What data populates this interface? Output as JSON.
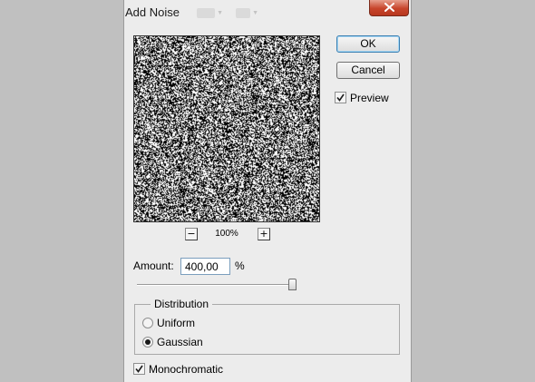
{
  "dialog": {
    "title": "Add Noise",
    "ok_label": "OK",
    "cancel_label": "Cancel",
    "preview": {
      "label": "Preview",
      "checked": true,
      "zoom_out_label": "−",
      "zoom_in_label": "+",
      "zoom_level": "100%"
    },
    "amount": {
      "label": "Amount:",
      "value": "400,00",
      "unit": "%",
      "slider_level_fraction": 1.0
    },
    "distribution": {
      "legend": "Distribution",
      "options": [
        {
          "label": "Uniform",
          "selected": false
        },
        {
          "label": "Gaussian",
          "selected": true
        }
      ]
    },
    "monochromatic": {
      "label": "Monochromatic",
      "checked": true
    }
  },
  "icons": {
    "close": "close-icon",
    "check": "check-icon",
    "zoom_out": "minus-icon",
    "zoom_in": "plus-icon"
  },
  "colors": {
    "background": "#c0c0c0",
    "dialog": "#ececec",
    "close_button": "#c7452b",
    "default_button_border": "#3c7fb1"
  }
}
